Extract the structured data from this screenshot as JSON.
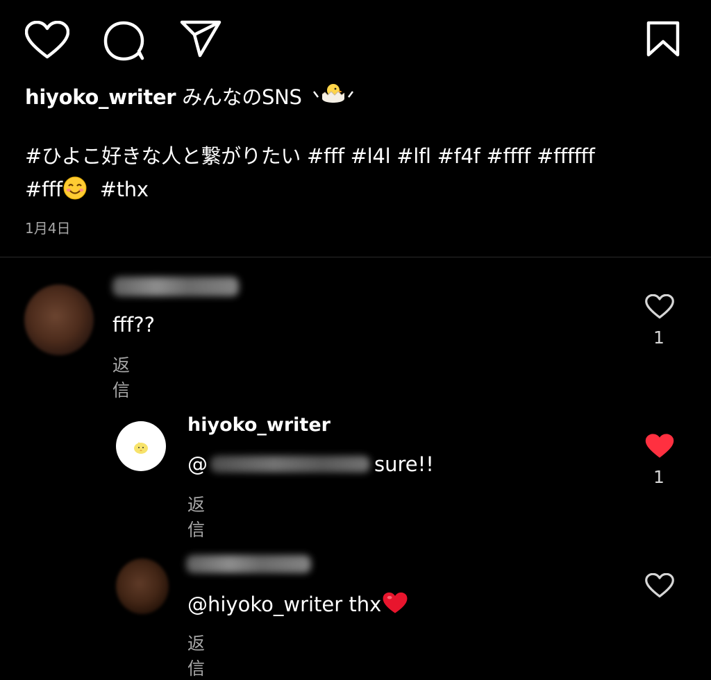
{
  "post": {
    "username": "hiyoko_writer",
    "caption_line1_text": "みんなのSNS",
    "caption_line2": "#ひよこ好きな人と繋がりたい #fff  #l4l #lfl #f4f #ffff #ffffff",
    "caption_line3_start": "#fff",
    "caption_line3_end": "#thx",
    "date": "1月4日"
  },
  "actions": {
    "icons": [
      "heart-icon",
      "comment-icon",
      "share-icon",
      "bookmark-icon"
    ]
  },
  "comments": [
    {
      "text": "fff??",
      "reply_label": "返信",
      "like_count": "1",
      "liked": false
    },
    {
      "username": "hiyoko_writer",
      "mention_prefix": "@",
      "text": "sure!!",
      "reply_label": "返信",
      "like_count": "1",
      "liked": true
    },
    {
      "text": "@hiyoko_writer thx",
      "reply_label": "返信",
      "liked": false
    }
  ],
  "colors": {
    "background": "#000000",
    "text": "#ffffff",
    "muted": "#a8a8a8",
    "like_red": "#ff3040"
  }
}
